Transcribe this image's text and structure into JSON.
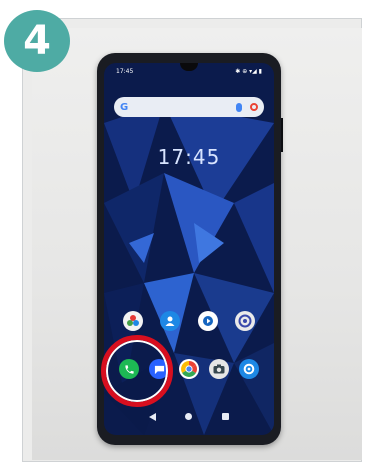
{
  "step": {
    "number": "4"
  },
  "phone": {
    "status_bar": {
      "time": "17:45",
      "indicators": "✱ ⊕ ▾◢ ▮"
    },
    "search_bar": {
      "logo": "G"
    },
    "clock": "17:45",
    "home_row": [
      {
        "label": "",
        "icon": "app-icon",
        "color": "#f3f3f3"
      },
      {
        "label": "",
        "icon": "contacts-icon",
        "color": "#1e88e5"
      },
      {
        "label": "",
        "icon": "app-icon",
        "color": "#ffffff"
      },
      {
        "label": "",
        "icon": "app-icon",
        "color": "#eaeaea"
      }
    ],
    "dock": [
      {
        "label": "",
        "icon": "phone-icon",
        "color": "#1db954"
      },
      {
        "label": "",
        "icon": "messages-icon",
        "color": "#2962ff"
      },
      {
        "label": "",
        "icon": "chrome-icon",
        "color": "#ffffff"
      },
      {
        "label": "",
        "icon": "camera-icon",
        "color": "#e6e6e6"
      },
      {
        "label": "",
        "icon": "settings-icon",
        "color": "#1e88e5"
      }
    ],
    "highlight": {
      "target": "phone-icon",
      "color": "#d80f1f"
    }
  }
}
